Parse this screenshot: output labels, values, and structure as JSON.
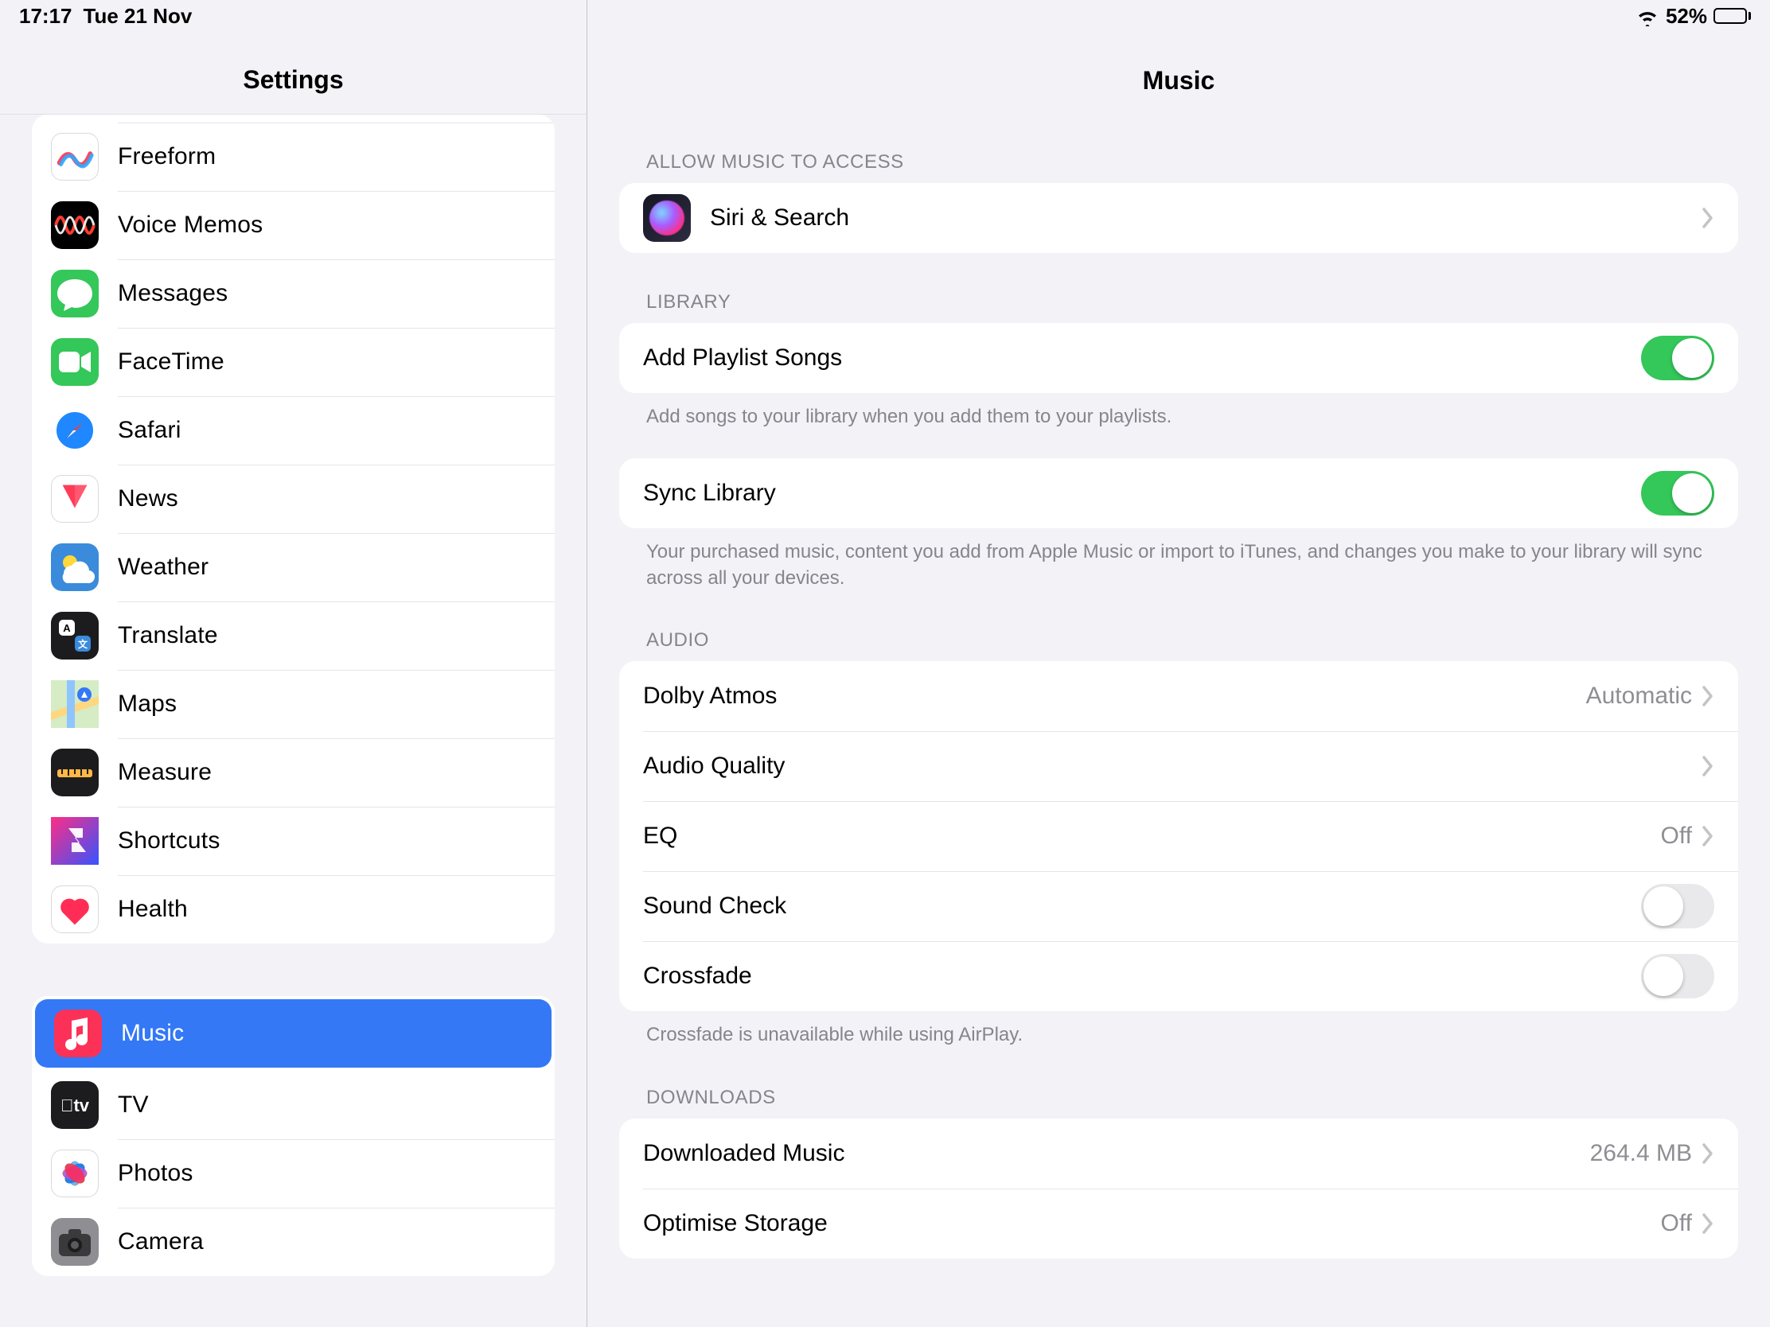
{
  "status": {
    "time": "17:17",
    "date": "Tue 21 Nov",
    "battery_text": "52%",
    "battery_pct": 52
  },
  "sidebar": {
    "title": "Settings",
    "group1": [
      {
        "name": "freeform",
        "label": "Freeform",
        "icon_bg": "#ffffff",
        "border": "#d9d9de"
      },
      {
        "name": "voice-memos",
        "label": "Voice Memos",
        "icon_bg": "#000000"
      },
      {
        "name": "messages",
        "label": "Messages",
        "icon_bg": "#34c759"
      },
      {
        "name": "facetime",
        "label": "FaceTime",
        "icon_bg": "#34c759"
      },
      {
        "name": "safari",
        "label": "Safari",
        "icon_bg": "#ffffff",
        "grad": "safari"
      },
      {
        "name": "news",
        "label": "News",
        "icon_bg": "#ffffff",
        "border": "#d9d9de"
      },
      {
        "name": "weather",
        "label": "Weather",
        "icon_bg": "#3a8bdb"
      },
      {
        "name": "translate",
        "label": "Translate",
        "icon_bg": "#1c1c1e"
      },
      {
        "name": "maps",
        "label": "Maps",
        "icon_bg": "#ffffff"
      },
      {
        "name": "measure",
        "label": "Measure",
        "icon_bg": "#1c1c1e"
      },
      {
        "name": "shortcuts",
        "label": "Shortcuts",
        "icon_bg": "#203ab0"
      },
      {
        "name": "health",
        "label": "Health",
        "icon_bg": "#ffffff",
        "border": "#d9d9de"
      }
    ],
    "group2": [
      {
        "name": "music",
        "label": "Music",
        "icon_bg": "#fc3158",
        "selected": true
      },
      {
        "name": "tv",
        "label": "TV",
        "icon_bg": "#1c1c1e"
      },
      {
        "name": "photos",
        "label": "Photos",
        "icon_bg": "#ffffff",
        "border": "#d9d9de"
      },
      {
        "name": "camera",
        "label": "Camera",
        "icon_bg": "#8e8e93"
      }
    ]
  },
  "detail": {
    "title": "Music",
    "sections": {
      "access": {
        "header": "Allow Music to Access",
        "rows": {
          "siri": "Siri & Search"
        }
      },
      "library": {
        "header": "Library",
        "add_playlist": {
          "label": "Add Playlist Songs",
          "on": true,
          "footer": "Add songs to your library when you add them to your playlists."
        },
        "sync_library": {
          "label": "Sync Library",
          "on": true,
          "footer": "Your purchased music, content you add from Apple Music or import to iTunes, and changes you make to your library will sync across all your devices."
        }
      },
      "audio": {
        "header": "Audio",
        "dolby": {
          "label": "Dolby Atmos",
          "value": "Automatic"
        },
        "quality": {
          "label": "Audio Quality",
          "value": ""
        },
        "eq": {
          "label": "EQ",
          "value": "Off"
        },
        "sound_check": {
          "label": "Sound Check",
          "on": false
        },
        "crossfade": {
          "label": "Crossfade",
          "on": false,
          "footer": "Crossfade is unavailable while using AirPlay."
        }
      },
      "downloads": {
        "header": "Downloads",
        "downloaded": {
          "label": "Downloaded Music",
          "value": "264.4 MB"
        },
        "optimise": {
          "label": "Optimise Storage",
          "value": "Off"
        }
      }
    }
  }
}
